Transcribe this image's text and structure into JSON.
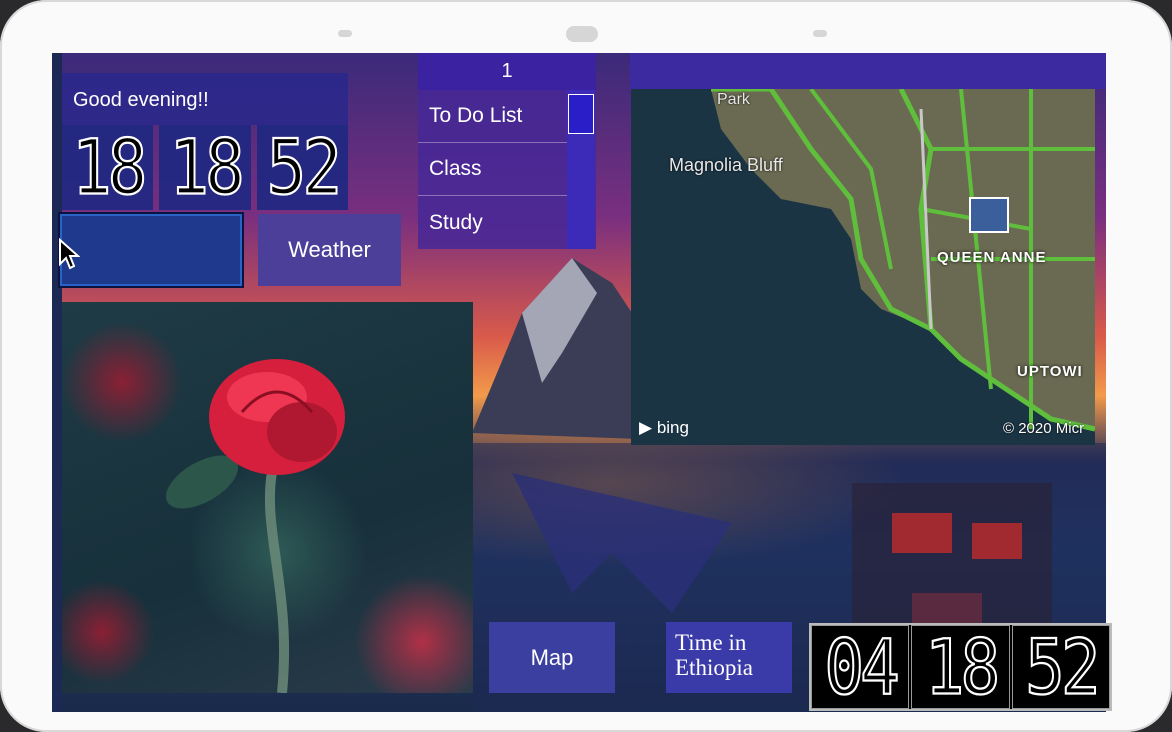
{
  "greeting": "Good evening!!",
  "local_clock": {
    "hours": "18",
    "minutes": "18",
    "seconds": "52"
  },
  "buttons": {
    "blank": "",
    "weather": "Weather",
    "map": "Map"
  },
  "todo": {
    "header": "1",
    "items": [
      "To Do List",
      "Class",
      "Study"
    ]
  },
  "map": {
    "labels": {
      "park": "Park",
      "magnolia": "Magnolia Bluff",
      "queen_anne": "QUEEN ANNE",
      "uptown": "UPTOWI"
    },
    "provider": "bing",
    "copyright": "© 2020 Micr"
  },
  "ethiopia": {
    "label_line1": "Time in",
    "label_line2": "Ethiopia",
    "hours": "04",
    "minutes": "18",
    "seconds": "52"
  }
}
